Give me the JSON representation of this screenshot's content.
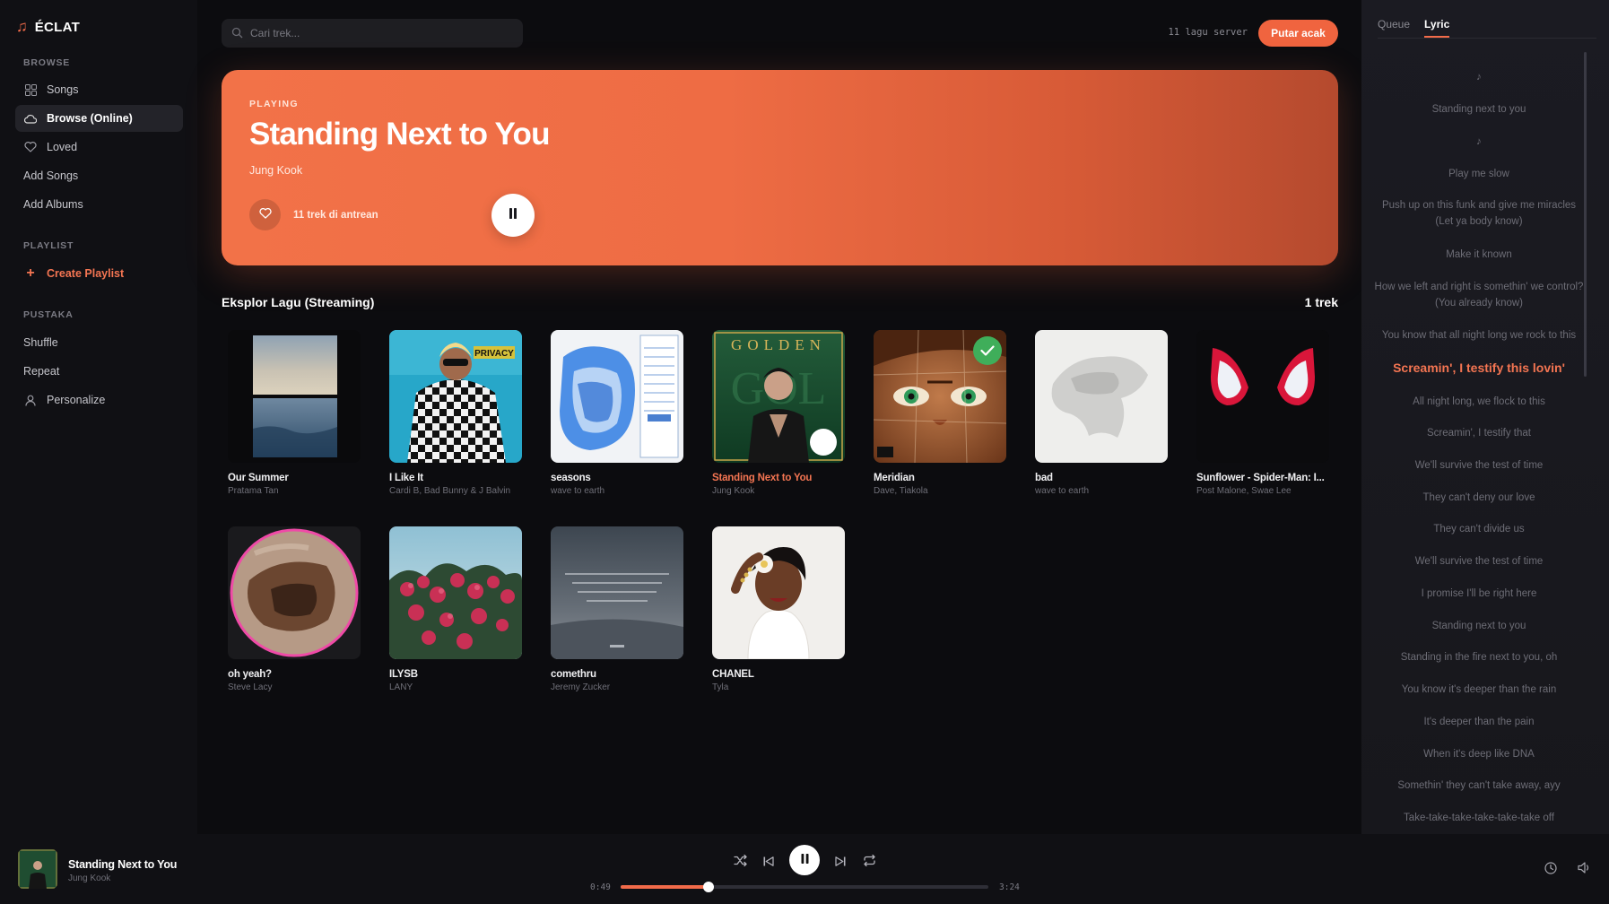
{
  "app": {
    "name": "ÉCLAT"
  },
  "sidebar": {
    "browse_title": "BROWSE",
    "browse_items": [
      {
        "label": "Songs",
        "icon": "grid-icon"
      },
      {
        "label": "Browse (Online)",
        "icon": "cloud-icon",
        "active": true
      },
      {
        "label": "Loved",
        "icon": "heart-icon"
      },
      {
        "label": "Add Songs"
      },
      {
        "label": "Add Albums"
      }
    ],
    "playlist_title": "PLAYLIST",
    "create_playlist": "Create Playlist",
    "library_title": "PUSTAKA",
    "library_items": [
      {
        "label": "Shuffle"
      },
      {
        "label": "Repeat"
      },
      {
        "label": "Personalize",
        "icon": "user-icon"
      }
    ]
  },
  "topbar": {
    "search_placeholder": "Cari trek...",
    "server_count": "11 lagu server",
    "shuffle_button": "Putar acak"
  },
  "hero": {
    "label": "PLAYING",
    "title": "Standing Next to You",
    "artist": "Jung Kook",
    "queue_info": "11 trek di antrean"
  },
  "section": {
    "title": "Eksplor Lagu (Streaming)",
    "count": "1 trek"
  },
  "tracks": [
    {
      "title": "Our Summer",
      "artist": "Pratama Tan"
    },
    {
      "title": "I Like It",
      "artist": "Cardi B, Bad Bunny & J Balvin"
    },
    {
      "title": "seasons",
      "artist": "wave to earth"
    },
    {
      "title": "Standing Next to You",
      "artist": "Jung Kook",
      "playing": true
    },
    {
      "title": "Meridian",
      "artist": "Dave, Tiakola"
    },
    {
      "title": "bad",
      "artist": "wave to earth"
    },
    {
      "title": "Sunflower - Spider-Man: I...",
      "artist": "Post Malone, Swae Lee"
    },
    {
      "title": "oh yeah?",
      "artist": "Steve Lacy"
    },
    {
      "title": "ILYSB",
      "artist": "LANY"
    },
    {
      "title": "comethru",
      "artist": "Jeremy Zucker"
    },
    {
      "title": "CHANEL",
      "artist": "Tyla"
    }
  ],
  "right_panel": {
    "tabs": [
      "Queue",
      "Lyric"
    ],
    "active_tab": "Lyric",
    "lyrics": [
      "♪",
      "Standing next to you",
      "♪",
      "Play me slow",
      "Push up on this funk and give me miracles (Let ya body know)",
      "Make it known",
      "How we left and right is somethin' we control? (You already know)",
      "You know that all night long we rock to this",
      "Screamin', I testify this lovin'",
      "All night long, we flock to this",
      "Screamin', I testify that",
      "We'll survive the test of time",
      "They can't deny our love",
      "They can't divide us",
      "We'll survive the test of time",
      "I promise I'll be right here",
      "Standing next to you",
      "Standing in the fire next to you, oh",
      "You know it's deeper than the rain",
      "It's deeper than the pain",
      "When it's deep like DNA",
      "Somethin' they can't take away, ayy",
      "Take-take-take-take-take-take off"
    ],
    "current_line": 8
  },
  "player": {
    "title": "Standing Next to You",
    "artist": "Jung Kook",
    "elapsed": "0:49",
    "duration": "3:24",
    "progress": 0.24
  },
  "colors": {
    "accent": "#f26b4a",
    "background": "#0c0c0f",
    "panel": "#18181d"
  }
}
